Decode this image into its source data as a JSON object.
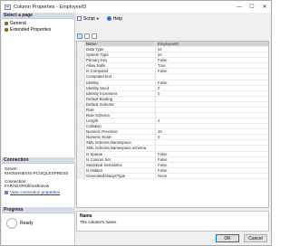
{
  "window": {
    "title": "Column Properties - EmployeeID",
    "minimize_glyph": "—",
    "maximize_glyph": "☐",
    "close_glyph": "✕"
  },
  "left": {
    "select_page_header": "Select a page",
    "pages": [
      {
        "label": "General",
        "icon": "wrench-icon"
      },
      {
        "label": "Extended Properties",
        "icon": "wrench-icon"
      }
    ],
    "connection_header": "Connection",
    "server_label": "Server:",
    "server_value": "KHOSHNEVIS-PC\\SQLEXPRESS",
    "connection_label": "Connection:",
    "connection_value": "FARADARS\\khoshnevis",
    "view_connection_link": "View connection properties",
    "progress_header": "Progress",
    "progress_status": "Ready"
  },
  "toolbar": {
    "script_label": "Script",
    "help_label": "Help"
  },
  "properties": [
    {
      "name": "Name",
      "value": "EmployeeID",
      "selected": true
    },
    {
      "name": "Data Type",
      "value": "int"
    },
    {
      "name": "System Type",
      "value": "int"
    },
    {
      "name": "Primary Key",
      "value": "False"
    },
    {
      "name": "Allow Nulls",
      "value": "True"
    },
    {
      "name": "Is Computed",
      "value": "False"
    },
    {
      "name": "Computed text",
      "value": ""
    },
    {
      "name": "Identity",
      "value": "False"
    },
    {
      "name": "Identity Seed",
      "value": "0"
    },
    {
      "name": "Identity Increment",
      "value": "0"
    },
    {
      "name": "Default Binding",
      "value": ""
    },
    {
      "name": "Default Schema",
      "value": ""
    },
    {
      "name": "Rule",
      "value": ""
    },
    {
      "name": "Rule Schema",
      "value": ""
    },
    {
      "name": "Length",
      "value": "4"
    },
    {
      "name": "Collation",
      "value": ""
    },
    {
      "name": "Numeric Precision",
      "value": "10"
    },
    {
      "name": "Numeric Scale",
      "value": "0"
    },
    {
      "name": "XML Schema Namespace",
      "value": ""
    },
    {
      "name": "XML Schema Namespace schema",
      "value": ""
    },
    {
      "name": "Is Sparse",
      "value": "False"
    },
    {
      "name": "Is Column Set",
      "value": "False"
    },
    {
      "name": "Statistical Semantics",
      "value": "False"
    },
    {
      "name": "Is Hidden",
      "value": "False"
    },
    {
      "name": "GeneratedAlwaysType",
      "value": "None"
    }
  ],
  "description": {
    "title": "Name",
    "text": "The column's name."
  },
  "buttons": {
    "ok": "OK",
    "cancel": "Cancel"
  }
}
